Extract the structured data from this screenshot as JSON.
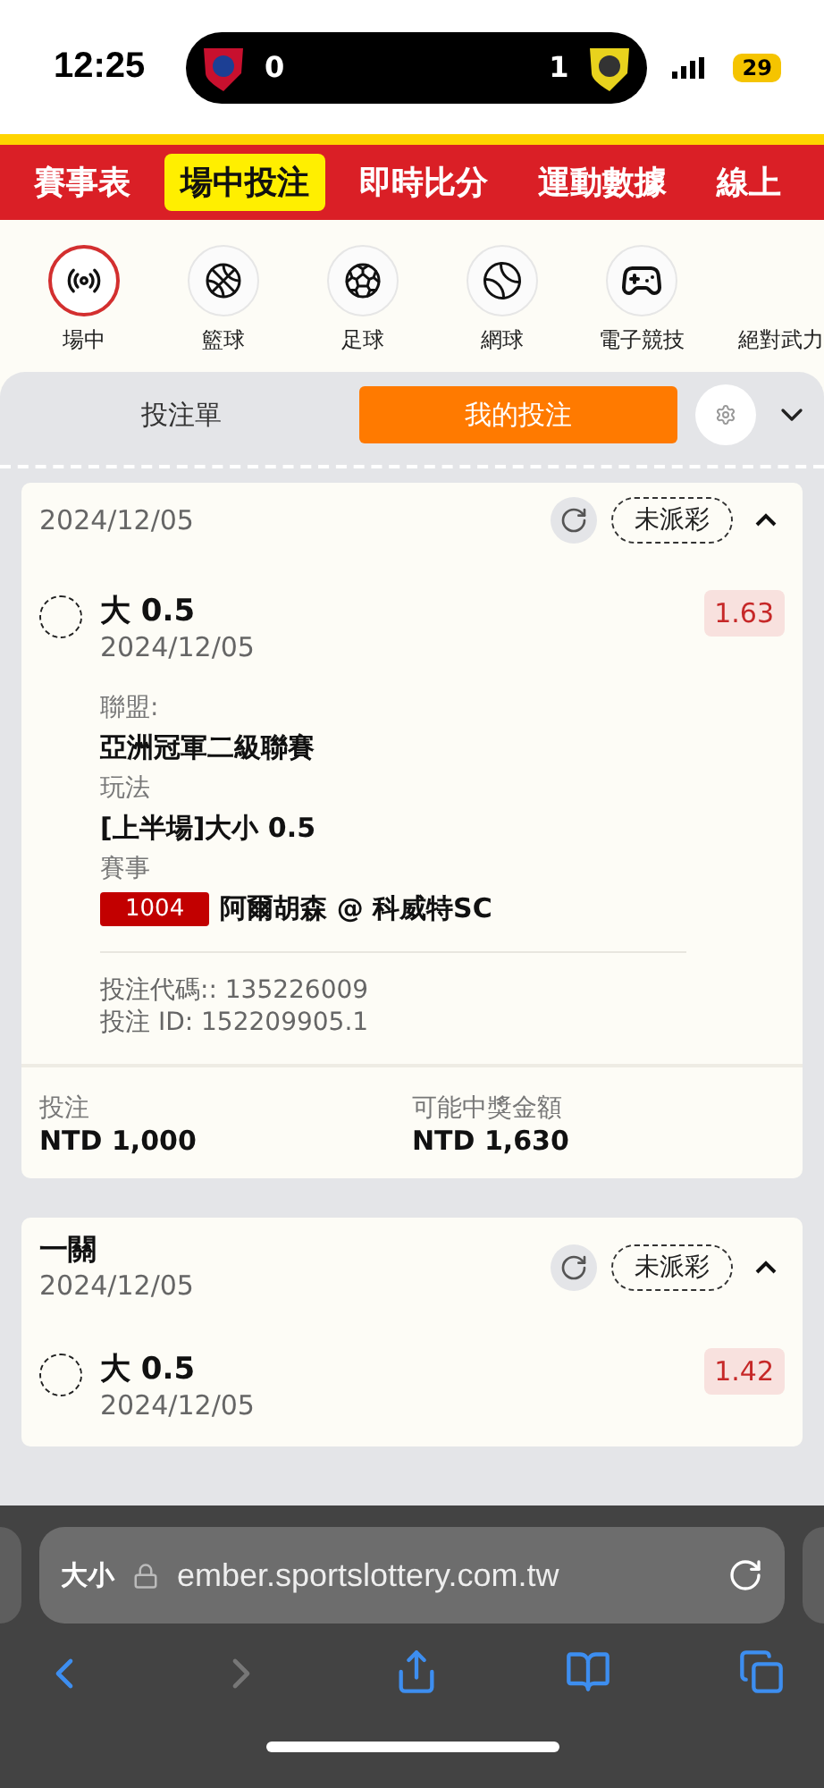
{
  "status_bar": {
    "time": "12:25",
    "home_score": "0",
    "away_score": "1",
    "battery": "29"
  },
  "nav_tabs": [
    {
      "label": "賽事表",
      "selected": false
    },
    {
      "label": "場中投注",
      "selected": true
    },
    {
      "label": "即時比分",
      "selected": false
    },
    {
      "label": "運動數據",
      "selected": false
    },
    {
      "label": "線上",
      "selected": false
    }
  ],
  "sports": [
    {
      "label": "場中",
      "kind": "live",
      "selected": true
    },
    {
      "label": "籃球",
      "kind": "basketball",
      "selected": false
    },
    {
      "label": "足球",
      "kind": "soccer",
      "selected": false
    },
    {
      "label": "網球",
      "kind": "tennis",
      "selected": false
    },
    {
      "label": "電子競技",
      "kind": "gamepad",
      "selected": false
    },
    {
      "label": "絕對武力",
      "kind": "label"
    }
  ],
  "slip_tabs": [
    {
      "label": "投注單",
      "selected": false
    },
    {
      "label": "我的投注",
      "selected": true
    }
  ],
  "bets": [
    {
      "date": "2024/12/05",
      "status": "未派彩",
      "expanded": true,
      "selections": [
        {
          "name": "大 0.5",
          "date": "2024/12/05",
          "odds": "1.63",
          "fields": [
            {
              "label": "聯盟:",
              "value": "亞洲冠軍二級聯賽"
            },
            {
              "label": "玩法",
              "value": "[上半場]大小 0.5"
            },
            {
              "label": "賽事",
              "code": "1004",
              "value": "阿爾胡森 @ 科威特SC"
            }
          ],
          "bet_code": "投注代碼:: 135226009",
          "bet_id": "投注 ID: 152209905.1"
        }
      ],
      "stake_label": "投注",
      "stake": "NTD 1,000",
      "payout_label": "可能中獎金額",
      "payout": "NTD 1,630"
    },
    {
      "title": "一關",
      "date": "2024/12/05",
      "status": "未派彩",
      "expanded": true,
      "selections": [
        {
          "name": "大 0.5",
          "date": "2024/12/05",
          "odds": "1.42"
        }
      ]
    }
  ],
  "browser": {
    "text_size": "大小",
    "url": "ember.sportslottery.com.tw",
    "back_disabled": false,
    "forward_disabled": true
  }
}
